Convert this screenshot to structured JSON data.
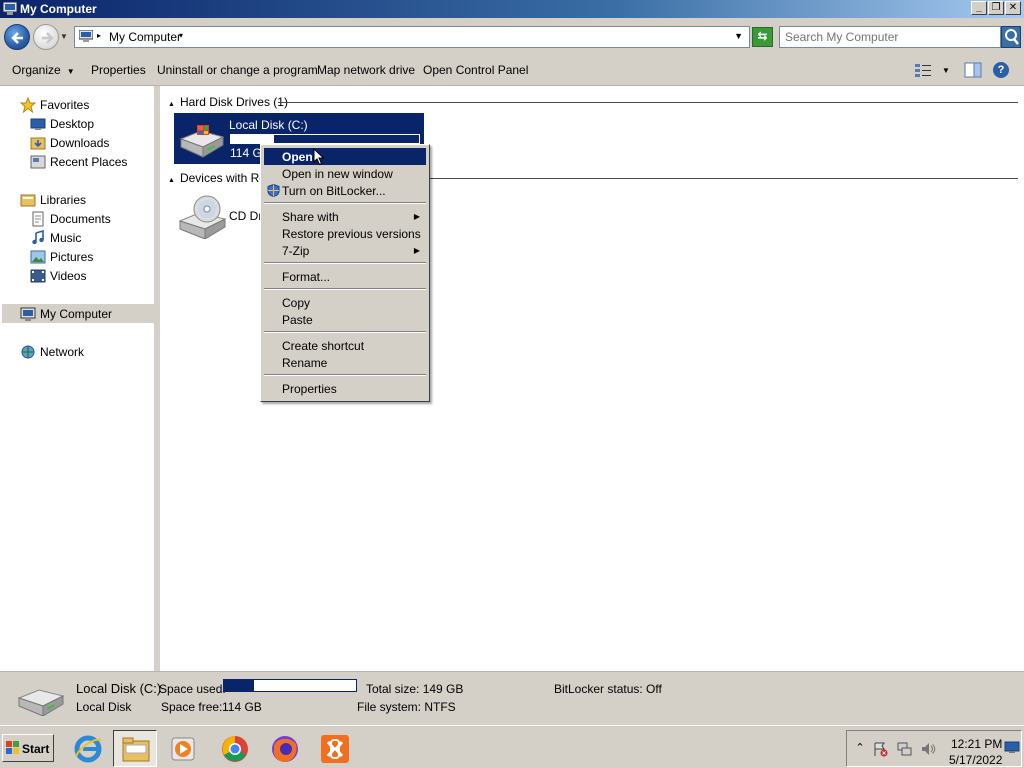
{
  "window": {
    "title": "My Computer",
    "caption_minimize": "_",
    "caption_restore": "❐",
    "caption_close": "✕"
  },
  "address_bar": {
    "location": "My Computer",
    "search_placeholder": "Search My Computer"
  },
  "command_bar": {
    "organize": "Organize",
    "properties": "Properties",
    "uninstall": "Uninstall or change a program",
    "map_drive": "Map network drive",
    "control_panel": "Open Control Panel",
    "help": "?"
  },
  "nav_pane": {
    "favorites": "Favorites",
    "desktop": "Desktop",
    "downloads": "Downloads",
    "recent_places": "Recent Places",
    "libraries": "Libraries",
    "documents": "Documents",
    "music": "Music",
    "pictures": "Pictures",
    "videos": "Videos",
    "my_computer": "My Computer",
    "network": "Network"
  },
  "content": {
    "group_hdd": "Hard Disk Drives (1)",
    "group_removable": "Devices with Rem",
    "drive_c_label": "Local Disk (C:)",
    "drive_c_free": "114 GB",
    "drive_c_used_fraction": 0.23,
    "cd_drive_label": "CD Dri"
  },
  "context_menu": {
    "open": "Open",
    "open_new_window": "Open in new window",
    "bitlocker": "Turn on BitLocker...",
    "share_with": "Share with",
    "restore_versions": "Restore previous versions",
    "seven_zip": "7-Zip",
    "format": "Format...",
    "copy": "Copy",
    "paste": "Paste",
    "create_shortcut": "Create shortcut",
    "rename": "Rename",
    "properties": "Properties"
  },
  "details_pane": {
    "name": "Local Disk (C:)",
    "type": "Local Disk",
    "space_used_label": "Space used:",
    "space_free_label": "Space free:",
    "space_free_value": "114 GB",
    "total_size": "Total size: 149 GB",
    "file_system": "File system: NTFS",
    "bitlocker_status": "BitLocker status: Off",
    "used_fraction": 0.23
  },
  "taskbar": {
    "start": "Start",
    "time": "12:21 PM",
    "date": "5/17/2022"
  },
  "colors": {
    "selection": "#0a246a",
    "face": "#d4d0c8"
  }
}
